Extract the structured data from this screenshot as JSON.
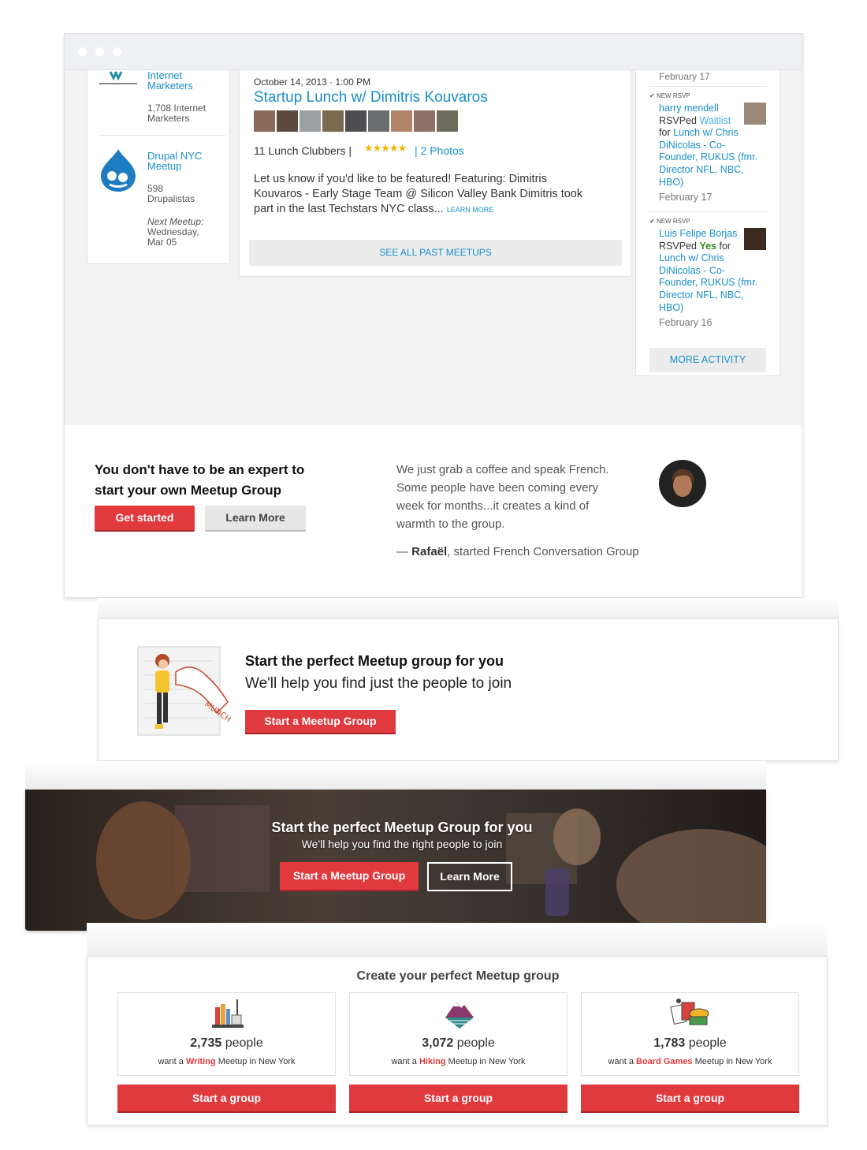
{
  "window1": {
    "left_column": {
      "group1": {
        "name_line1": "Internet",
        "name_line2": "Marketers",
        "members_line1": "1,708 Internet",
        "members_line2": "Marketers"
      },
      "group2": {
        "name_line1": "Drupal NYC",
        "name_line2": "Meetup",
        "members_line1": "598",
        "members_line2": "Drupalistas",
        "next_label": "Next Meetup:",
        "next_line1": "Wednesday,",
        "next_line2": "Mar 05"
      }
    },
    "event": {
      "datetime": "October 14, 2013 · 1:00 PM",
      "title": "Startup Lunch w/ Dimitris Kouvaros",
      "attendees": "11 Lunch Clubbers |",
      "photos": "| 2 Photos",
      "desc_line1": "Let us know if you'd like to be featured! Featuring: Dimitris",
      "desc_line2": "Kouvaros - Early Stage Team @ Silicon Valley Bank Dimitris took",
      "desc_line3": "part in the last Techstars NYC class...",
      "learn_more": "LEARN MORE",
      "see_all": "SEE ALL PAST MEETUPS"
    },
    "activity": {
      "top_date": "February 17",
      "items": [
        {
          "tag": "NEW RSVP",
          "name": "harry mendell",
          "rsvped": "RSVPed",
          "status": "Waitlist",
          "for": "for",
          "l1": "Lunch w/ Chris",
          "l2": "DiNicolas - Co-",
          "l3": "Founder, RUKUS (fmr.",
          "l4": "Director NFL, NBC,",
          "l5": "HBO)",
          "date": "February 17"
        },
        {
          "tag": "NEW RSVP",
          "name": "Luis Felipe Borjas",
          "rsvped": "RSVPed",
          "status": "Yes",
          "for": "for",
          "l1": "Lunch w/ Chris",
          "l2": "DiNicolas - Co-",
          "l3": "Founder, RUKUS (fmr.",
          "l4": "Director NFL, NBC,",
          "l5": "HBO)",
          "date": "February 16"
        }
      ],
      "more": "MORE ACTIVITY"
    },
    "cta": {
      "head_line1": "You don't have to be an expert to",
      "head_line2": "start your own Meetup Group",
      "get_started": "Get started",
      "learn_more": "Learn More",
      "quote_line1": "We just grab a coffee and speak French.",
      "quote_line2": "Some people have been coming every",
      "quote_line3": "week for months...it creates a kind of",
      "quote_line4": "warmth to the group.",
      "dash": "—",
      "author": "Rafaël",
      "author_rest": ", started French Conversation Group"
    }
  },
  "window2": {
    "title": "Start the perfect Meetup group for you",
    "subtitle": "We'll help you find just the people to join",
    "button": "Start a Meetup Group",
    "illustration_text": "MUNCH"
  },
  "window3": {
    "title": "Start the perfect Meetup Group for you",
    "subtitle": "We'll help you find the right people to join",
    "primary_button": "Start a Meetup Group",
    "secondary_button": "Learn More"
  },
  "window4": {
    "title": "Create your perfect Meetup group",
    "cards": [
      {
        "icon": "books-icon",
        "count": "2,735",
        "people": "people",
        "want": "want a",
        "topic": "Writing",
        "rest": "Meetup in New York",
        "button": "Start a group"
      },
      {
        "icon": "mountain-icon",
        "count": "3,072",
        "people": "people",
        "want": "want a",
        "topic": "Hiking",
        "rest": "Meetup in New York",
        "button": "Start a group"
      },
      {
        "icon": "board-games-icon",
        "count": "1,783",
        "people": "people",
        "want": "want a",
        "topic": "Board Games",
        "rest": "Meetup in New York",
        "button": "Start a group"
      }
    ]
  },
  "colors": {
    "accent_red": "#e0393e",
    "link_blue": "#1a8fc9",
    "waitlist_blue": "#46b0e0",
    "yes_green": "#2e8b1f"
  }
}
